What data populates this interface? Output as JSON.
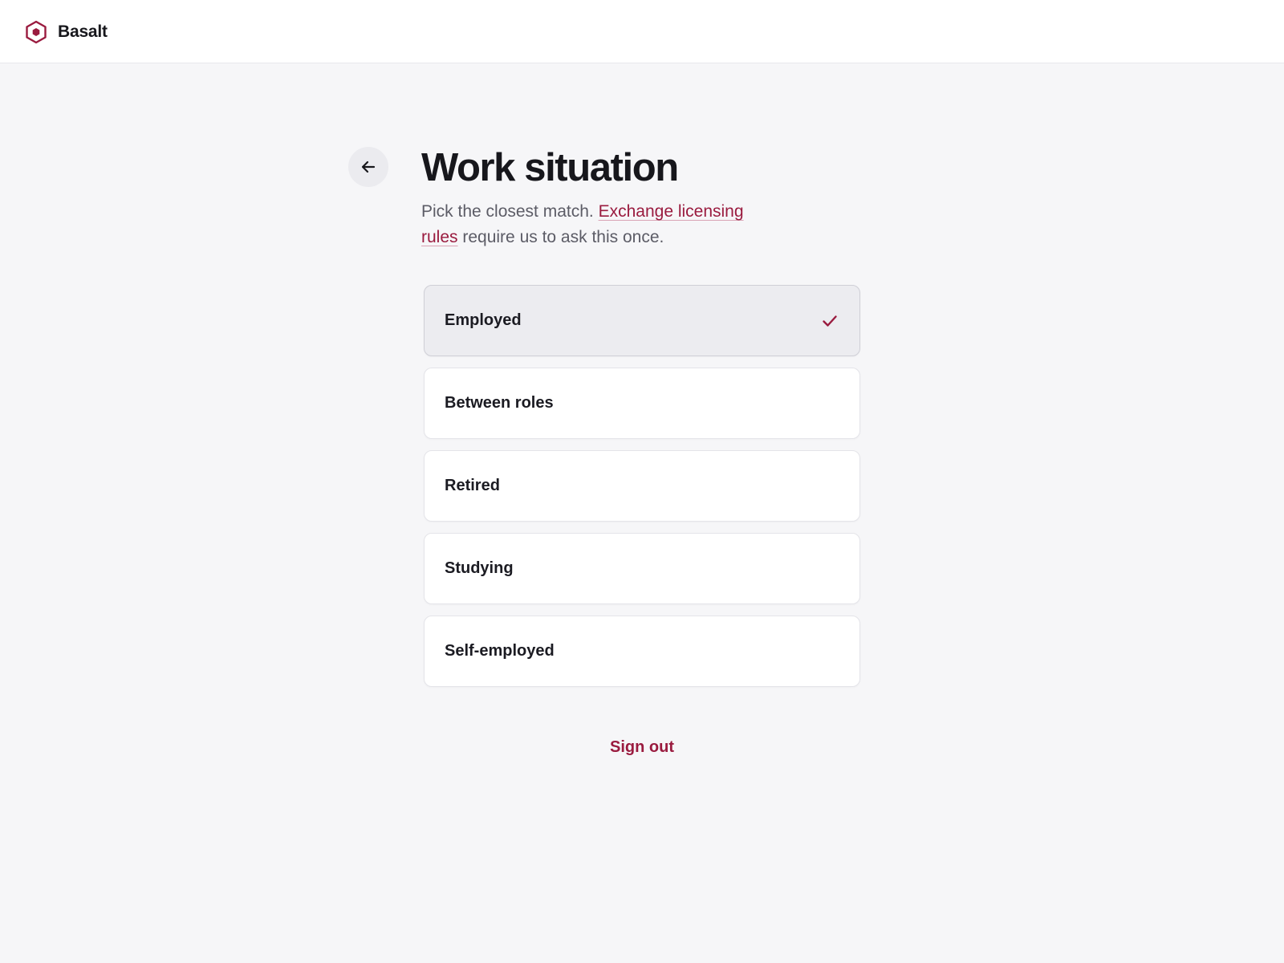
{
  "app": {
    "brand_name": "Basalt",
    "logo_icon": "hexagon-logo-icon",
    "accent_color": "#9a1b3f"
  },
  "header": {
    "back_icon": "arrow-left-icon",
    "title": "Work situation"
  },
  "intro": {
    "text_before": "Pick the closest match. ",
    "link_text": "Exchange licensing rules",
    "text_after": " require us to ask this once."
  },
  "options": [
    {
      "label": "Employed",
      "selected": true
    },
    {
      "label": "Between roles",
      "selected": false
    },
    {
      "label": "Retired",
      "selected": false
    },
    {
      "label": "Studying",
      "selected": false
    },
    {
      "label": "Self-employed",
      "selected": false
    }
  ],
  "selected_icon": "checkmark-icon",
  "footer": {
    "signout_label": "Sign out"
  }
}
